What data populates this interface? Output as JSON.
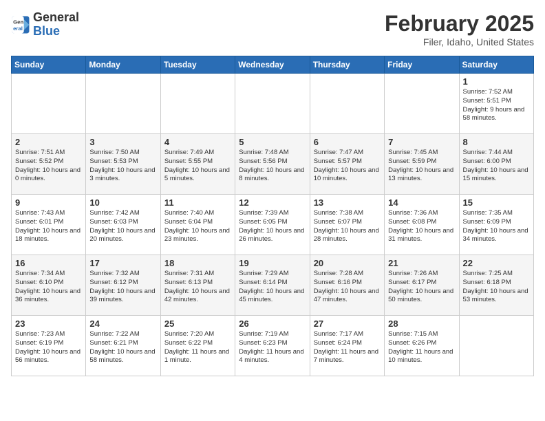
{
  "logo": {
    "line1": "General",
    "line2": "Blue"
  },
  "calendar": {
    "title": "February 2025",
    "subtitle": "Filer, Idaho, United States"
  },
  "weekdays": [
    "Sunday",
    "Monday",
    "Tuesday",
    "Wednesday",
    "Thursday",
    "Friday",
    "Saturday"
  ],
  "weeks": [
    [
      {
        "day": "",
        "info": ""
      },
      {
        "day": "",
        "info": ""
      },
      {
        "day": "",
        "info": ""
      },
      {
        "day": "",
        "info": ""
      },
      {
        "day": "",
        "info": ""
      },
      {
        "day": "",
        "info": ""
      },
      {
        "day": "1",
        "info": "Sunrise: 7:52 AM\nSunset: 5:51 PM\nDaylight: 9 hours and 58 minutes."
      }
    ],
    [
      {
        "day": "2",
        "info": "Sunrise: 7:51 AM\nSunset: 5:52 PM\nDaylight: 10 hours and 0 minutes."
      },
      {
        "day": "3",
        "info": "Sunrise: 7:50 AM\nSunset: 5:53 PM\nDaylight: 10 hours and 3 minutes."
      },
      {
        "day": "4",
        "info": "Sunrise: 7:49 AM\nSunset: 5:55 PM\nDaylight: 10 hours and 5 minutes."
      },
      {
        "day": "5",
        "info": "Sunrise: 7:48 AM\nSunset: 5:56 PM\nDaylight: 10 hours and 8 minutes."
      },
      {
        "day": "6",
        "info": "Sunrise: 7:47 AM\nSunset: 5:57 PM\nDaylight: 10 hours and 10 minutes."
      },
      {
        "day": "7",
        "info": "Sunrise: 7:45 AM\nSunset: 5:59 PM\nDaylight: 10 hours and 13 minutes."
      },
      {
        "day": "8",
        "info": "Sunrise: 7:44 AM\nSunset: 6:00 PM\nDaylight: 10 hours and 15 minutes."
      }
    ],
    [
      {
        "day": "9",
        "info": "Sunrise: 7:43 AM\nSunset: 6:01 PM\nDaylight: 10 hours and 18 minutes."
      },
      {
        "day": "10",
        "info": "Sunrise: 7:42 AM\nSunset: 6:03 PM\nDaylight: 10 hours and 20 minutes."
      },
      {
        "day": "11",
        "info": "Sunrise: 7:40 AM\nSunset: 6:04 PM\nDaylight: 10 hours and 23 minutes."
      },
      {
        "day": "12",
        "info": "Sunrise: 7:39 AM\nSunset: 6:05 PM\nDaylight: 10 hours and 26 minutes."
      },
      {
        "day": "13",
        "info": "Sunrise: 7:38 AM\nSunset: 6:07 PM\nDaylight: 10 hours and 28 minutes."
      },
      {
        "day": "14",
        "info": "Sunrise: 7:36 AM\nSunset: 6:08 PM\nDaylight: 10 hours and 31 minutes."
      },
      {
        "day": "15",
        "info": "Sunrise: 7:35 AM\nSunset: 6:09 PM\nDaylight: 10 hours and 34 minutes."
      }
    ],
    [
      {
        "day": "16",
        "info": "Sunrise: 7:34 AM\nSunset: 6:10 PM\nDaylight: 10 hours and 36 minutes."
      },
      {
        "day": "17",
        "info": "Sunrise: 7:32 AM\nSunset: 6:12 PM\nDaylight: 10 hours and 39 minutes."
      },
      {
        "day": "18",
        "info": "Sunrise: 7:31 AM\nSunset: 6:13 PM\nDaylight: 10 hours and 42 minutes."
      },
      {
        "day": "19",
        "info": "Sunrise: 7:29 AM\nSunset: 6:14 PM\nDaylight: 10 hours and 45 minutes."
      },
      {
        "day": "20",
        "info": "Sunrise: 7:28 AM\nSunset: 6:16 PM\nDaylight: 10 hours and 47 minutes."
      },
      {
        "day": "21",
        "info": "Sunrise: 7:26 AM\nSunset: 6:17 PM\nDaylight: 10 hours and 50 minutes."
      },
      {
        "day": "22",
        "info": "Sunrise: 7:25 AM\nSunset: 6:18 PM\nDaylight: 10 hours and 53 minutes."
      }
    ],
    [
      {
        "day": "23",
        "info": "Sunrise: 7:23 AM\nSunset: 6:19 PM\nDaylight: 10 hours and 56 minutes."
      },
      {
        "day": "24",
        "info": "Sunrise: 7:22 AM\nSunset: 6:21 PM\nDaylight: 10 hours and 58 minutes."
      },
      {
        "day": "25",
        "info": "Sunrise: 7:20 AM\nSunset: 6:22 PM\nDaylight: 11 hours and 1 minute."
      },
      {
        "day": "26",
        "info": "Sunrise: 7:19 AM\nSunset: 6:23 PM\nDaylight: 11 hours and 4 minutes."
      },
      {
        "day": "27",
        "info": "Sunrise: 7:17 AM\nSunset: 6:24 PM\nDaylight: 11 hours and 7 minutes."
      },
      {
        "day": "28",
        "info": "Sunrise: 7:15 AM\nSunset: 6:26 PM\nDaylight: 11 hours and 10 minutes."
      },
      {
        "day": "",
        "info": ""
      }
    ]
  ]
}
